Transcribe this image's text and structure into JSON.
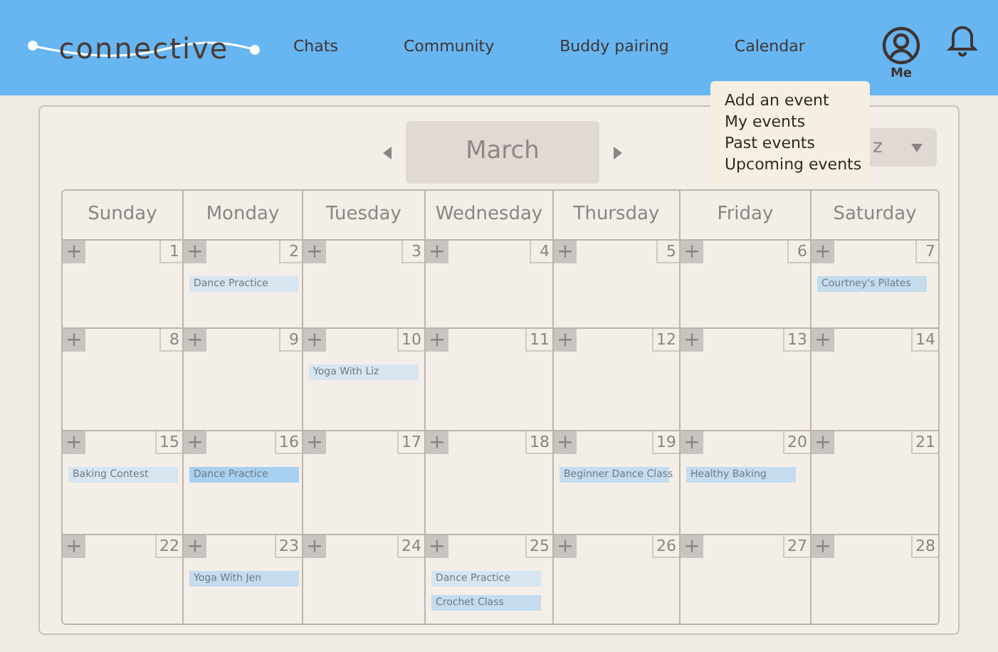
{
  "logo": "connective",
  "nav": [
    "Chats",
    "Community",
    "Buddy pairing",
    "Calendar"
  ],
  "profile_label": "Me",
  "calendar_menu": [
    "Add an event",
    "My events",
    "Past events",
    "Upcoming events"
  ],
  "month": "March",
  "view_select": "z",
  "weekdays": [
    "Sunday",
    "Monday",
    "Tuesday",
    "Wednesday",
    "Thursday",
    "Friday",
    "Saturday"
  ],
  "weeks": [
    [
      {
        "add": "+",
        "day": "1"
      },
      {
        "add": "+",
        "day": "2",
        "events": [
          {
            "title": "Dance Practice",
            "color": "#d6e5ef"
          }
        ]
      },
      {
        "add": "+",
        "day": "3"
      },
      {
        "add": "+",
        "day": "4"
      },
      {
        "add": "+",
        "day": "5"
      },
      {
        "add": "+",
        "day": "6"
      },
      {
        "add": "+",
        "day": "7",
        "events": [
          {
            "title": "Courtney's Pilates",
            "color": "#c5dcee"
          }
        ]
      }
    ],
    [
      {
        "add": "+",
        "day": "8"
      },
      {
        "add": "+",
        "day": "9"
      },
      {
        "add": "+",
        "day": "10",
        "events": [
          {
            "title": "Yoga With Liz",
            "color": "#d6e5ef"
          }
        ]
      },
      {
        "add": "+",
        "day": "11"
      },
      {
        "add": "+",
        "day": "12"
      },
      {
        "add": "+",
        "day": "13"
      },
      {
        "add": "+",
        "day": "14"
      }
    ],
    [
      {
        "add": "+",
        "day": "15",
        "events": [
          {
            "title": "Baking Contest",
            "color": "#d6e5ef"
          }
        ]
      },
      {
        "add": "+",
        "day": "16",
        "events": [
          {
            "title": "Dance Practice",
            "color": "#a8d0f0"
          }
        ]
      },
      {
        "add": "+",
        "day": "17"
      },
      {
        "add": "+",
        "day": "18"
      },
      {
        "add": "+",
        "day": "19",
        "events": [
          {
            "title": "Beginner Dance Class",
            "color": "#c5dcee"
          }
        ]
      },
      {
        "add": "+",
        "day": "20",
        "events": [
          {
            "title": "Healthy Baking",
            "color": "#c5dcee"
          }
        ]
      },
      {
        "add": "+",
        "day": "21"
      }
    ],
    [
      {
        "add": "+",
        "day": "22"
      },
      {
        "add": "+",
        "day": "23",
        "events": [
          {
            "title": "Yoga With Jen",
            "color": "#c5dcee"
          }
        ]
      },
      {
        "add": "+",
        "day": "24"
      },
      {
        "add": "+",
        "day": "25",
        "events": [
          {
            "title": "Dance Practice",
            "color": "#d6e5ef"
          },
          {
            "title": "Crochet Class",
            "color": "#c5dcee"
          }
        ]
      },
      {
        "add": "+",
        "day": "26"
      },
      {
        "add": "+",
        "day": "27"
      },
      {
        "add": "+",
        "day": "28"
      }
    ]
  ]
}
